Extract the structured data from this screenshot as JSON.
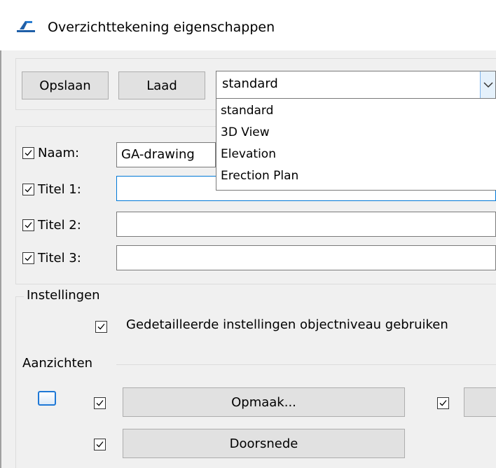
{
  "window": {
    "title": "Overzichttekening eigenschappen"
  },
  "toolbar": {
    "save_label": "Opslaan",
    "load_label": "Laad",
    "preset_value": "standard",
    "preset_options": [
      "standard",
      "3D View",
      "Elevation",
      "Erection Plan"
    ]
  },
  "fields": {
    "name_label": "Naam:",
    "name_value": "GA-drawing",
    "title1_label": "Titel 1:",
    "title1_value": "",
    "title2_label": "Titel 2:",
    "title2_value": "",
    "title3_label": "Titel 3:",
    "title3_value": ""
  },
  "settings": {
    "group_label": "Instellingen",
    "detailed_label": "Gedetailleerde instellingen objectniveau gebruiken"
  },
  "views": {
    "group_label": "Aanzichten",
    "layout_button": "Opmaak...",
    "section_button": "Doorsnede"
  },
  "colors": {
    "accent": "#0078d7",
    "background": "#f0f0f0"
  }
}
